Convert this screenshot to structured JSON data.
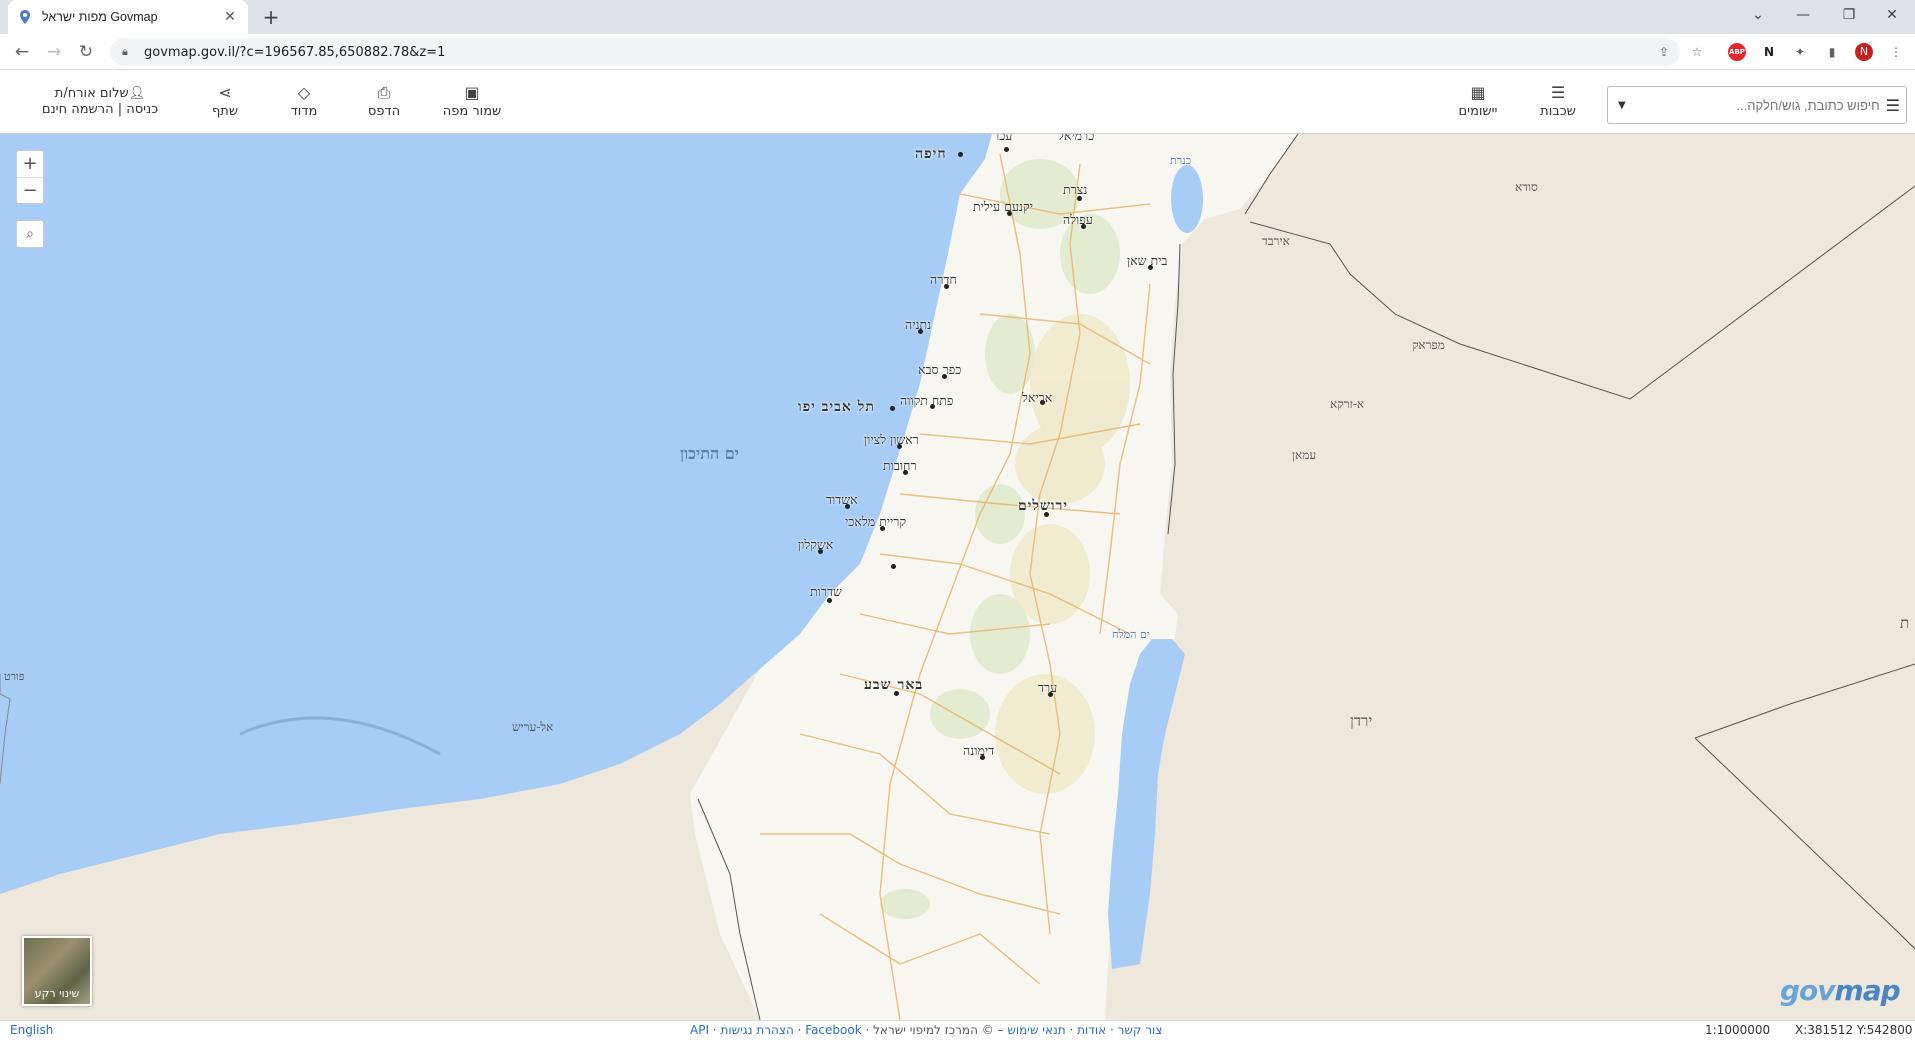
{
  "browser": {
    "tab_title": "מפות ישראל Govmap",
    "url": "govmap.gov.il/?c=196567.85,650882.78&z=1",
    "avatar_letter": "N",
    "abp_label": "ABP"
  },
  "toolbar": {
    "login_greeting": "שלום אורח/ת",
    "login_links": "כניסה | הרשמה חינם",
    "share": "שתף",
    "measure": "מדוד",
    "print": "הדפס",
    "save_map": "שמור מפה",
    "apps": "יישומים",
    "layers": "שכבות",
    "search_placeholder": "חיפוש כתובת, גוש/חלקה..."
  },
  "map": {
    "sea_label": "ים התיכון",
    "dead_sea": "ים המלח",
    "kinneret": "כנרת",
    "basemap_label": "שינוי רקע",
    "logo_gov": "gov",
    "logo_map": "map",
    "cities": [
      {
        "name": "עכו"
      },
      {
        "name": "כרמיאל"
      },
      {
        "name": "חיפה"
      },
      {
        "name": "נצרת"
      },
      {
        "name": "יקנעם עילית"
      },
      {
        "name": "עפולה"
      },
      {
        "name": "בית שאן"
      },
      {
        "name": "חדרה"
      },
      {
        "name": "נתניה"
      },
      {
        "name": "כפר סבא"
      },
      {
        "name": "פתח תקווה"
      },
      {
        "name": "תל אביב יפו"
      },
      {
        "name": "אריאל"
      },
      {
        "name": "ראשון לציון"
      },
      {
        "name": "רחובות"
      },
      {
        "name": "אשדוד"
      },
      {
        "name": "ירושלים"
      },
      {
        "name": "קריית מלאכי"
      },
      {
        "name": "אשקלון"
      },
      {
        "name": "שדרות"
      },
      {
        "name": "באר שבע"
      },
      {
        "name": "ערד"
      },
      {
        "name": "דימונה"
      }
    ],
    "neighbors": [
      {
        "name": "סודא"
      },
      {
        "name": "אירבד"
      },
      {
        "name": "מפראק"
      },
      {
        "name": "א-זרקא"
      },
      {
        "name": "עמאן"
      },
      {
        "name": "ירדן"
      },
      {
        "name": "אל-עריש"
      },
      {
        "name": "פורט"
      },
      {
        "name": "ת"
      }
    ]
  },
  "footer": {
    "english": "English",
    "copyright": "© המרכז למיפוי ישראל",
    "links": [
      "תנאי שימוש",
      "אודות",
      "צור קשר",
      "Facebook",
      "הצהרת נגישות",
      "API"
    ],
    "scale": "1:1000000",
    "coords": "X:381512 Y:542800"
  },
  "colors": {
    "sea": "#a7cdf7",
    "land": "#eee7dc",
    "israel": "#f7f6f0",
    "logo": "#4b86c2"
  }
}
